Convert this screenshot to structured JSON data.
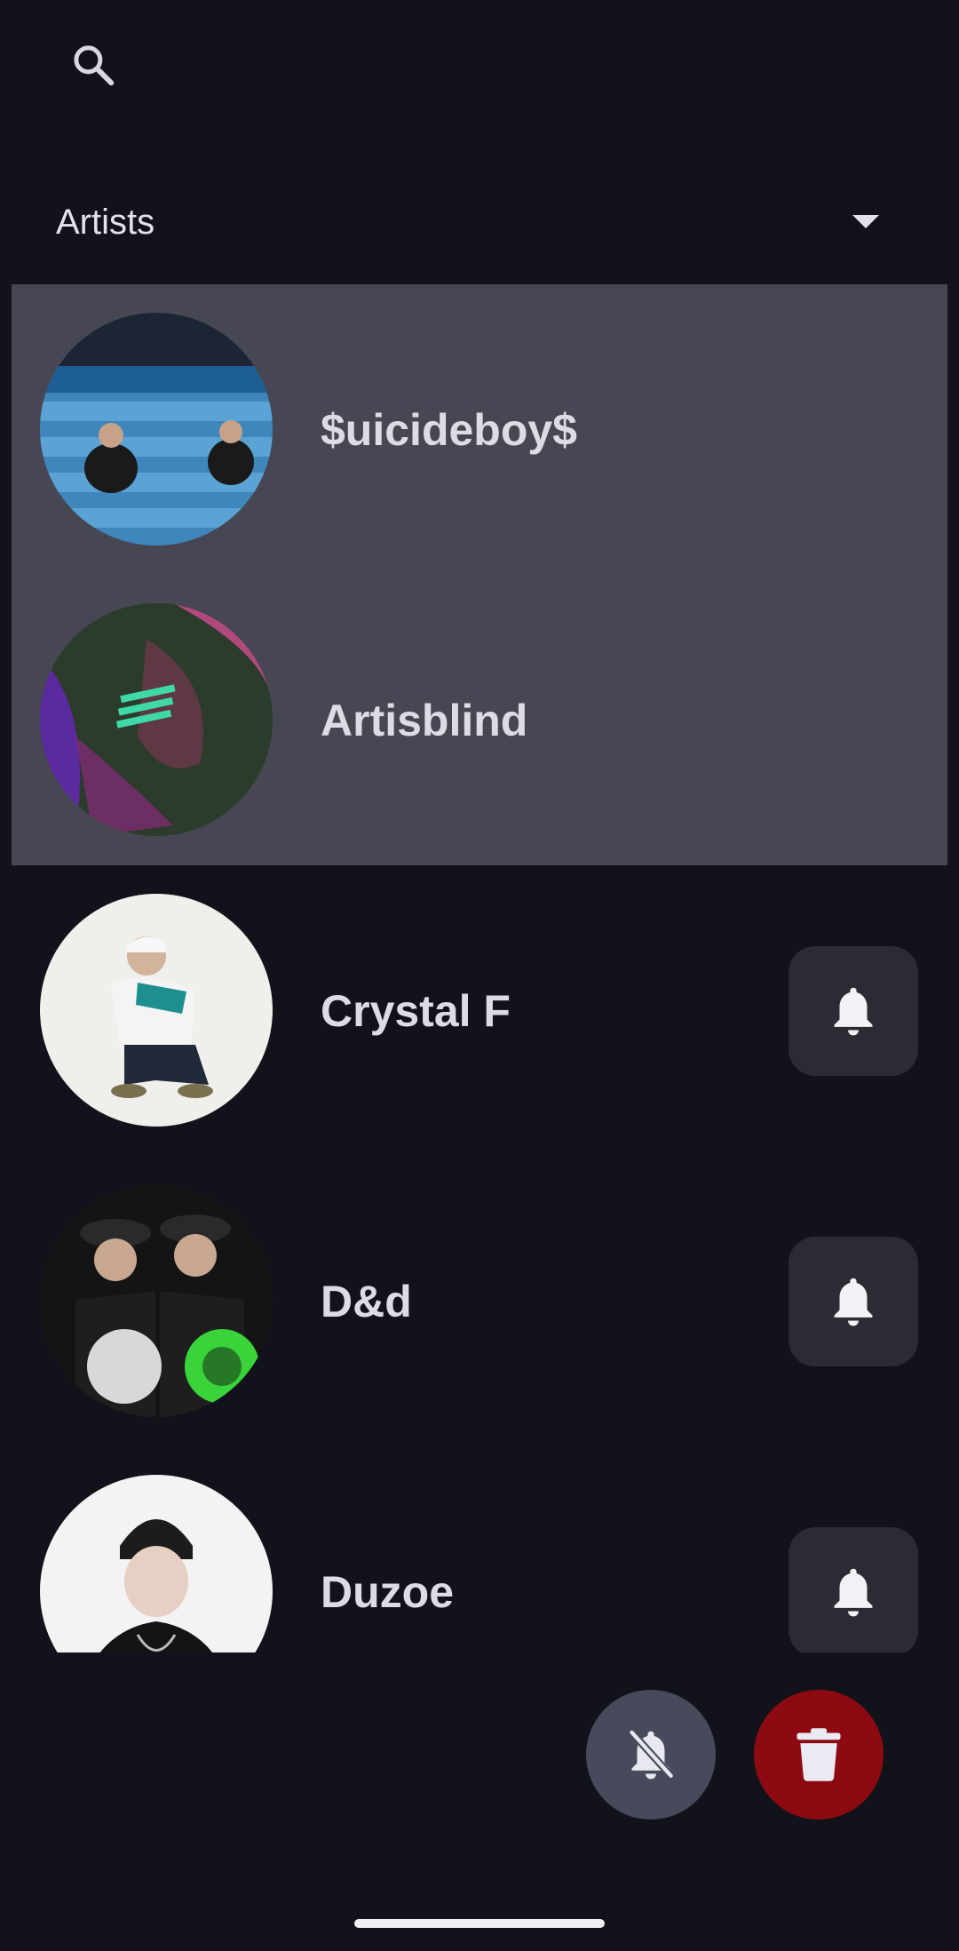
{
  "header": {
    "search_icon": "search-icon"
  },
  "filter": {
    "selected": "Artists"
  },
  "artists": [
    {
      "name": "$uicideboy$",
      "selected": true
    },
    {
      "name": "Artisblind",
      "selected": true
    },
    {
      "name": "Crystal F",
      "selected": false
    },
    {
      "name": "D&d",
      "selected": false
    },
    {
      "name": "Duzoe",
      "selected": false
    }
  ],
  "fabs": {
    "mute_icon": "bell-off-icon",
    "delete_icon": "trash-icon"
  },
  "colors": {
    "background": "#12131a",
    "selected_row": "#474753",
    "bell_button": "#2b2c33",
    "mute_fab": "#474a5b",
    "delete_fab": "#8e0a12"
  }
}
